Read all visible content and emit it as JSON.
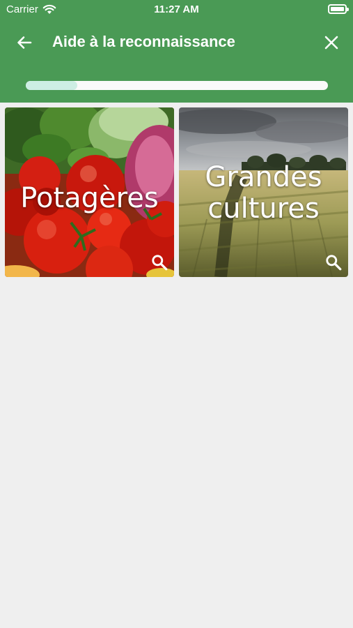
{
  "status_bar": {
    "carrier": "Carrier",
    "time": "11:27 AM",
    "icons": [
      "wifi-icon",
      "battery-icon"
    ]
  },
  "toolbar": {
    "title": "Aide à la reconnaissance",
    "back_icon": "arrow-left-icon",
    "close_icon": "close-icon"
  },
  "progress": {
    "value": 0.17
  },
  "categories": [
    {
      "label": "Potagères",
      "icon": "search-icon"
    },
    {
      "label": "Grandes cultures",
      "icon": "search-icon"
    }
  ],
  "colors": {
    "header": "#4a9a55",
    "background": "#efefef",
    "progress_track": "#fafafa",
    "progress_fill": "#cdeee4"
  }
}
